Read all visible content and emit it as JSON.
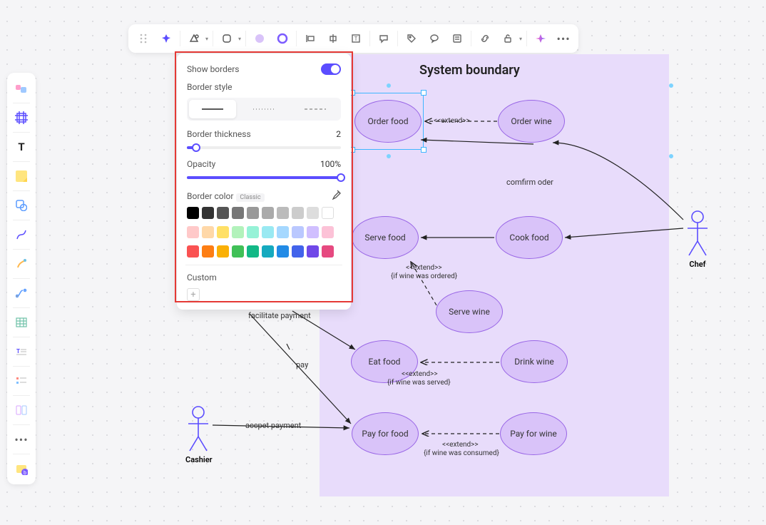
{
  "panel": {
    "show_borders_label": "Show borders",
    "border_style_label": "Border style",
    "border_thickness_label": "Border thickness",
    "border_thickness_value": "2",
    "opacity_label": "Opacity",
    "opacity_value": "100%",
    "border_color_label": "Border color",
    "classic_tag": "Classic",
    "custom_label": "Custom",
    "swatches_row1": [
      "#000000",
      "#333333",
      "#555555",
      "#777777",
      "#999999",
      "#aaaaaa",
      "#bbbbbb",
      "#cccccc",
      "#dddddd",
      "#ffffff"
    ],
    "swatches_row2": [
      "#ffc9c9",
      "#ffd8a8",
      "#ffe066",
      "#b2f2bb",
      "#96f2d7",
      "#99e9f2",
      "#a5d8ff",
      "#bac8ff",
      "#d0bfff",
      "#fcc2d7"
    ],
    "swatches_row3": [
      "#fa5252",
      "#fd7e14",
      "#fab005",
      "#40c057",
      "#12b886",
      "#15aabf",
      "#228be6",
      "#4263eb",
      "#7048e8",
      "#e64980"
    ]
  },
  "diagram": {
    "title": "System boundary",
    "actors": {
      "cashier": "Cashier",
      "chef": "Chef"
    },
    "use_cases": {
      "order_food": "Order food",
      "order_wine": "Order wine",
      "serve_food": "Serve food",
      "cook_food": "Cook food",
      "serve_wine": "Serve wine",
      "eat_food": "Eat food",
      "drink_wine": "Drink wine",
      "pay_for_food": "Pay for food",
      "pay_for_wine": "Pay for wine"
    },
    "edge_labels": {
      "extend1": "<<extend>>",
      "confirm_order": "comfirm oder",
      "extend_wine_ordered": "<<extend>>",
      "cond_wine_ordered": "{if wine was ordered}",
      "facilitate_payment": "facilitate payment",
      "pay": "pay",
      "extend_wine_served": "<<extend>>",
      "cond_wine_served": "{if wine was served}",
      "accept_payment": "accpet payment",
      "extend_wine_consumed": "<<extend>>",
      "cond_wine_consumed": "{if wine was consumed}"
    }
  }
}
